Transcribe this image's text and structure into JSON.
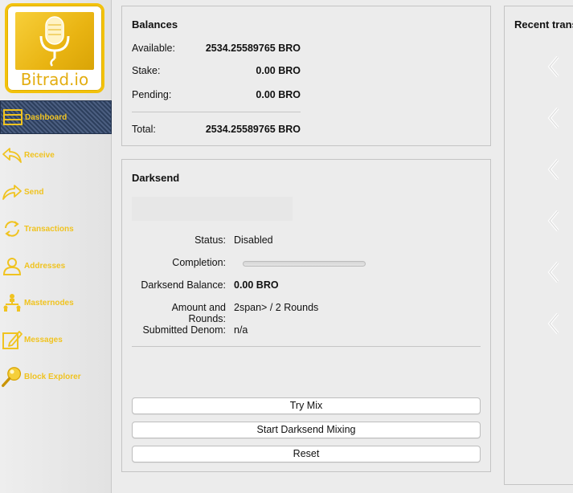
{
  "brand": {
    "logo_text": "Bitrad.io",
    "accent_color": "#f0c320"
  },
  "sidebar": {
    "items": [
      {
        "label": "Dashboard",
        "icon": "dashboard-icon",
        "active": true
      },
      {
        "label": "Receive",
        "icon": "receive-icon"
      },
      {
        "label": "Send",
        "icon": "send-icon"
      },
      {
        "label": "Transactions",
        "icon": "transactions-icon"
      },
      {
        "label": "Addresses",
        "icon": "addresses-icon"
      },
      {
        "label": "Masternodes",
        "icon": "masternodes-icon"
      },
      {
        "label": "Messages",
        "icon": "messages-icon"
      },
      {
        "label": "Block Explorer",
        "icon": "block-explorer-icon"
      }
    ]
  },
  "balances": {
    "title": "Balances",
    "available_label": "Available:",
    "available_value": "2534.25589765 BRO",
    "stake_label": "Stake:",
    "stake_value": "0.00 BRO",
    "pending_label": "Pending:",
    "pending_value": "0.00 BRO",
    "total_label": "Total:",
    "total_value": "2534.25589765 BRO"
  },
  "darksend": {
    "title": "Darksend",
    "status_label": "Status:",
    "status_value": "Disabled",
    "completion_label": "Completion:",
    "completion_progress": 0,
    "balance_label": "Darksend Balance:",
    "balance_value": "0.00 BRO",
    "rounds_label": "Amount and Rounds:",
    "rounds_value": "2span> / 2 Rounds",
    "denom_label": "Submitted Denom:",
    "denom_value": "n/a",
    "try_mix_label": "Try Mix",
    "start_mixing_label": "Start Darksend Mixing",
    "reset_label": "Reset"
  },
  "recent": {
    "title": "Recent transactions",
    "item_icon": "chevron-left-icon",
    "item_count": 6
  }
}
